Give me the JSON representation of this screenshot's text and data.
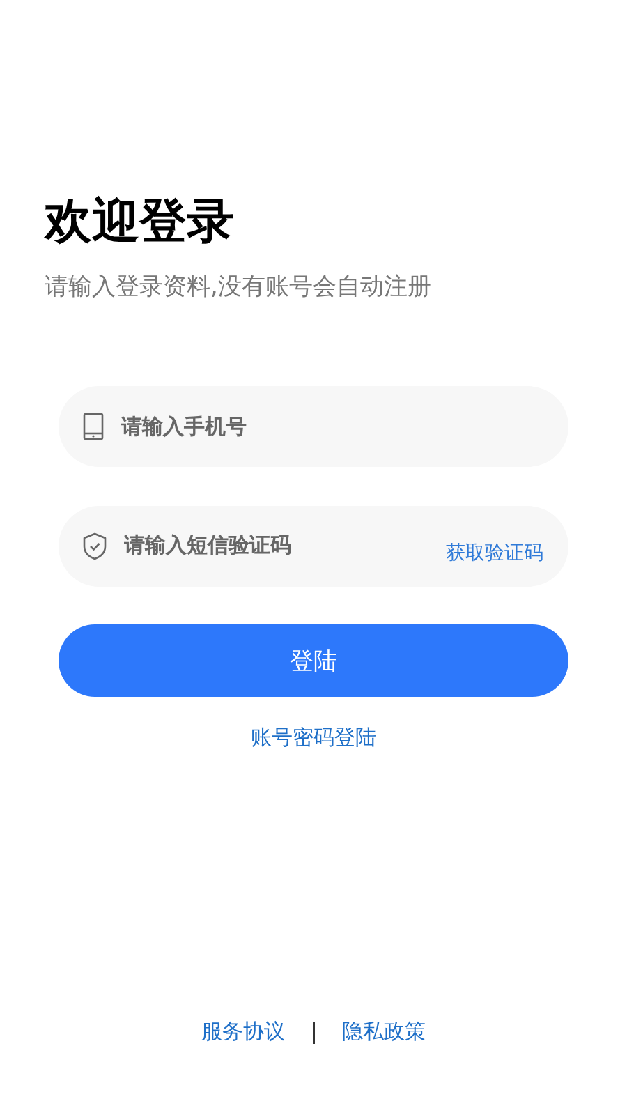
{
  "title": "欢迎登录",
  "subtitle": "请输入登录资料,没有账号会自动注册",
  "fields": [
    {
      "kind": "phone",
      "placeholder": "请输入手机号"
    },
    {
      "kind": "code",
      "placeholder": "请输入短信验证码",
      "action": "获取验证码"
    }
  ],
  "login_button": "登陆",
  "alt_login_link": "账号密码登陆",
  "footer_links": [
    "服务协议",
    "隐私政策"
  ]
}
